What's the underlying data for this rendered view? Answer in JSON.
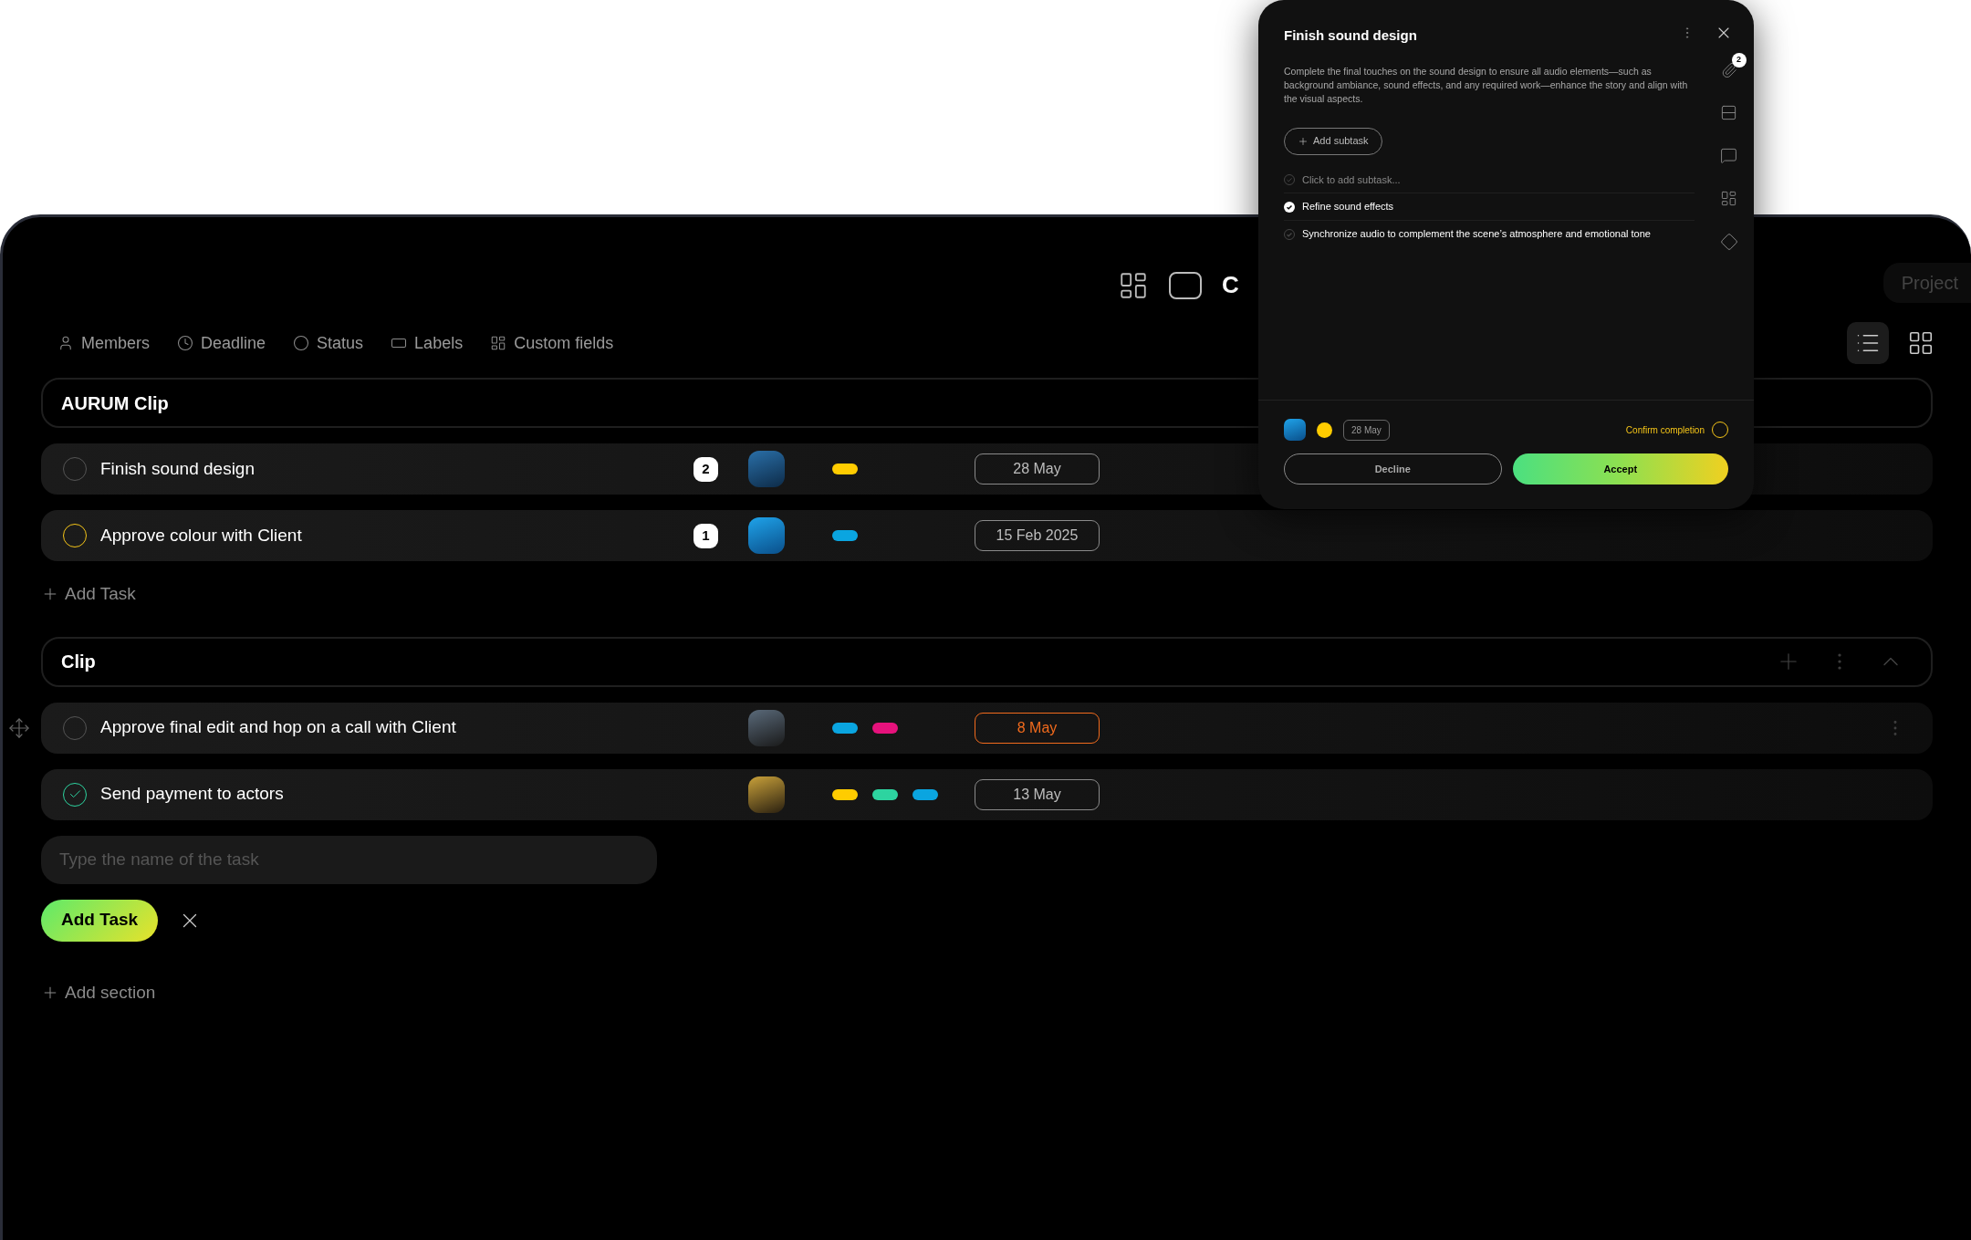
{
  "topbar": {
    "title_fragment": "C",
    "project_button": "Project"
  },
  "filters": [
    {
      "kind": "members",
      "label": "Members"
    },
    {
      "kind": "deadline",
      "label": "Deadline"
    },
    {
      "kind": "status",
      "label": "Status"
    },
    {
      "kind": "labels",
      "label": "Labels"
    },
    {
      "kind": "custom",
      "label": "Custom fields"
    }
  ],
  "view_modes": [
    {
      "kind": "list",
      "selected": true
    },
    {
      "kind": "grid",
      "selected": false
    }
  ],
  "sections": [
    {
      "title": "AURUM Clip",
      "show_actions": false,
      "tasks": [
        {
          "title": "Finish sound design",
          "kind": "open",
          "checked": false,
          "subtasks": "2",
          "labels": [
            {
              "color": "#ffcc00"
            }
          ],
          "date": "28 May",
          "overdue": false,
          "hovered": false
        },
        {
          "title": "Approve colour with Client",
          "kind": "pending",
          "checked": false,
          "subtasks": "1",
          "labels": [
            {
              "color": "#0aa5e0"
            }
          ],
          "date": "15 Feb 2025",
          "overdue": false,
          "hovered": false
        }
      ],
      "add_task": "Add Task"
    },
    {
      "title": "Clip",
      "show_actions": true,
      "tasks": [
        {
          "title": "Approve final edit and hop on a call with Client",
          "kind": "open",
          "checked": false,
          "labels": [
            {
              "color": "#0aa5e0"
            },
            {
              "color": "#e6127c"
            }
          ],
          "date": "8 May",
          "overdue": true,
          "hovered": true
        },
        {
          "title": "Send payment to actors",
          "checked": true,
          "labels": [
            {
              "color": "#ffcc00"
            },
            {
              "color": "#2dd4a0"
            },
            {
              "color": "#0aa5e0"
            }
          ],
          "date": "13 May",
          "overdue": false,
          "hovered": false
        }
      ],
      "new_task": {
        "placeholder": "Type the name of the task",
        "submit": "Add Task"
      }
    }
  ],
  "add_section": "Add section",
  "task_panel": {
    "title": "Finish sound design",
    "description": "Complete the final touches on the sound design to ensure all audio elements—such as background ambiance, sound effects, and any required work—enhance the story and align with the visual aspects.",
    "add_subtask": "Add subtask",
    "new_subtask_placeholder": "Click to add subtask...",
    "subtasks": [
      {
        "title": "Refine sound effects",
        "checked": true
      },
      {
        "title": "Synchronize audio to complement the scene’s atmosphere and emotional tone",
        "checked": false
      }
    ],
    "attachments_count": "2",
    "labels": [
      {
        "color": "#ffcc00"
      }
    ],
    "date": "28 May",
    "confirm_label": "Confirm completion",
    "confirmed": false,
    "decline": "Decline",
    "accept": "Accept"
  }
}
